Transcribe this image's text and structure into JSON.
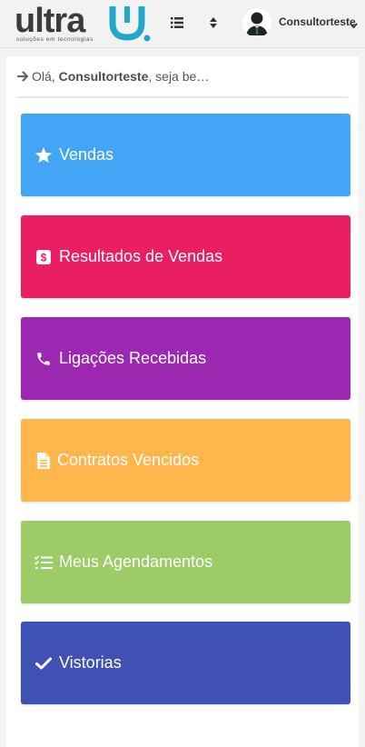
{
  "header": {
    "brand": "ultra",
    "tagline": "soluções em tecnologias",
    "username": "Consultorteste",
    "icons": [
      "list-icon",
      "sort-icon",
      "user-avatar-icon",
      "caret-down-icon"
    ]
  },
  "greeting": {
    "prefix": "Olá, ",
    "name": "Consultorteste",
    "suffix": ", seja be…"
  },
  "tiles": [
    {
      "label": "Vendas",
      "color": "#42a5f5",
      "icon": "star-icon"
    },
    {
      "label": "Resultados de Vendas",
      "color": "#e91e63",
      "icon": "dollar-icon"
    },
    {
      "label": "Ligações Recebidas",
      "color": "#9c27b0",
      "icon": "phone-icon"
    },
    {
      "label": "Contratos Vencidos",
      "color": "#ffb74d",
      "icon": "document-icon"
    },
    {
      "label": "Meus Agendamentos",
      "color": "#9ccc65",
      "icon": "checklist-icon"
    },
    {
      "label": "Vistorias",
      "color": "#3f51b5",
      "icon": "check-icon"
    }
  ]
}
